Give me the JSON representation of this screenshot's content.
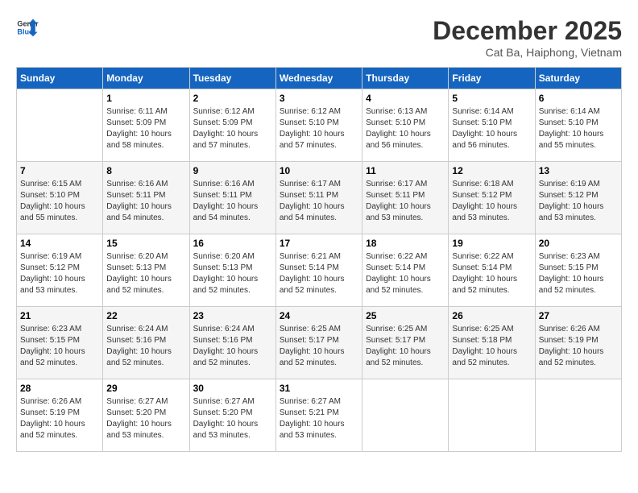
{
  "header": {
    "logo_line1": "General",
    "logo_line2": "Blue",
    "month_title": "December 2025",
    "location": "Cat Ba, Haiphong, Vietnam"
  },
  "weekdays": [
    "Sunday",
    "Monday",
    "Tuesday",
    "Wednesday",
    "Thursday",
    "Friday",
    "Saturday"
  ],
  "weeks": [
    [
      {
        "day": "",
        "empty": true
      },
      {
        "day": "1",
        "sunrise": "6:11 AM",
        "sunset": "5:09 PM",
        "daylight": "10 hours and 58 minutes."
      },
      {
        "day": "2",
        "sunrise": "6:12 AM",
        "sunset": "5:09 PM",
        "daylight": "10 hours and 57 minutes."
      },
      {
        "day": "3",
        "sunrise": "6:12 AM",
        "sunset": "5:10 PM",
        "daylight": "10 hours and 57 minutes."
      },
      {
        "day": "4",
        "sunrise": "6:13 AM",
        "sunset": "5:10 PM",
        "daylight": "10 hours and 56 minutes."
      },
      {
        "day": "5",
        "sunrise": "6:14 AM",
        "sunset": "5:10 PM",
        "daylight": "10 hours and 56 minutes."
      },
      {
        "day": "6",
        "sunrise": "6:14 AM",
        "sunset": "5:10 PM",
        "daylight": "10 hours and 55 minutes."
      }
    ],
    [
      {
        "day": "7",
        "sunrise": "6:15 AM",
        "sunset": "5:10 PM",
        "daylight": "10 hours and 55 minutes."
      },
      {
        "day": "8",
        "sunrise": "6:16 AM",
        "sunset": "5:11 PM",
        "daylight": "10 hours and 54 minutes."
      },
      {
        "day": "9",
        "sunrise": "6:16 AM",
        "sunset": "5:11 PM",
        "daylight": "10 hours and 54 minutes."
      },
      {
        "day": "10",
        "sunrise": "6:17 AM",
        "sunset": "5:11 PM",
        "daylight": "10 hours and 54 minutes."
      },
      {
        "day": "11",
        "sunrise": "6:17 AM",
        "sunset": "5:11 PM",
        "daylight": "10 hours and 53 minutes."
      },
      {
        "day": "12",
        "sunrise": "6:18 AM",
        "sunset": "5:12 PM",
        "daylight": "10 hours and 53 minutes."
      },
      {
        "day": "13",
        "sunrise": "6:19 AM",
        "sunset": "5:12 PM",
        "daylight": "10 hours and 53 minutes."
      }
    ],
    [
      {
        "day": "14",
        "sunrise": "6:19 AM",
        "sunset": "5:12 PM",
        "daylight": "10 hours and 53 minutes."
      },
      {
        "day": "15",
        "sunrise": "6:20 AM",
        "sunset": "5:13 PM",
        "daylight": "10 hours and 52 minutes."
      },
      {
        "day": "16",
        "sunrise": "6:20 AM",
        "sunset": "5:13 PM",
        "daylight": "10 hours and 52 minutes."
      },
      {
        "day": "17",
        "sunrise": "6:21 AM",
        "sunset": "5:14 PM",
        "daylight": "10 hours and 52 minutes."
      },
      {
        "day": "18",
        "sunrise": "6:22 AM",
        "sunset": "5:14 PM",
        "daylight": "10 hours and 52 minutes."
      },
      {
        "day": "19",
        "sunrise": "6:22 AM",
        "sunset": "5:14 PM",
        "daylight": "10 hours and 52 minutes."
      },
      {
        "day": "20",
        "sunrise": "6:23 AM",
        "sunset": "5:15 PM",
        "daylight": "10 hours and 52 minutes."
      }
    ],
    [
      {
        "day": "21",
        "sunrise": "6:23 AM",
        "sunset": "5:15 PM",
        "daylight": "10 hours and 52 minutes."
      },
      {
        "day": "22",
        "sunrise": "6:24 AM",
        "sunset": "5:16 PM",
        "daylight": "10 hours and 52 minutes."
      },
      {
        "day": "23",
        "sunrise": "6:24 AM",
        "sunset": "5:16 PM",
        "daylight": "10 hours and 52 minutes."
      },
      {
        "day": "24",
        "sunrise": "6:25 AM",
        "sunset": "5:17 PM",
        "daylight": "10 hours and 52 minutes."
      },
      {
        "day": "25",
        "sunrise": "6:25 AM",
        "sunset": "5:17 PM",
        "daylight": "10 hours and 52 minutes."
      },
      {
        "day": "26",
        "sunrise": "6:25 AM",
        "sunset": "5:18 PM",
        "daylight": "10 hours and 52 minutes."
      },
      {
        "day": "27",
        "sunrise": "6:26 AM",
        "sunset": "5:19 PM",
        "daylight": "10 hours and 52 minutes."
      }
    ],
    [
      {
        "day": "28",
        "sunrise": "6:26 AM",
        "sunset": "5:19 PM",
        "daylight": "10 hours and 52 minutes."
      },
      {
        "day": "29",
        "sunrise": "6:27 AM",
        "sunset": "5:20 PM",
        "daylight": "10 hours and 53 minutes."
      },
      {
        "day": "30",
        "sunrise": "6:27 AM",
        "sunset": "5:20 PM",
        "daylight": "10 hours and 53 minutes."
      },
      {
        "day": "31",
        "sunrise": "6:27 AM",
        "sunset": "5:21 PM",
        "daylight": "10 hours and 53 minutes."
      },
      {
        "day": "",
        "empty": true
      },
      {
        "day": "",
        "empty": true
      },
      {
        "day": "",
        "empty": true
      }
    ]
  ],
  "labels": {
    "sunrise": "Sunrise:",
    "sunset": "Sunset:",
    "daylight": "Daylight:"
  }
}
